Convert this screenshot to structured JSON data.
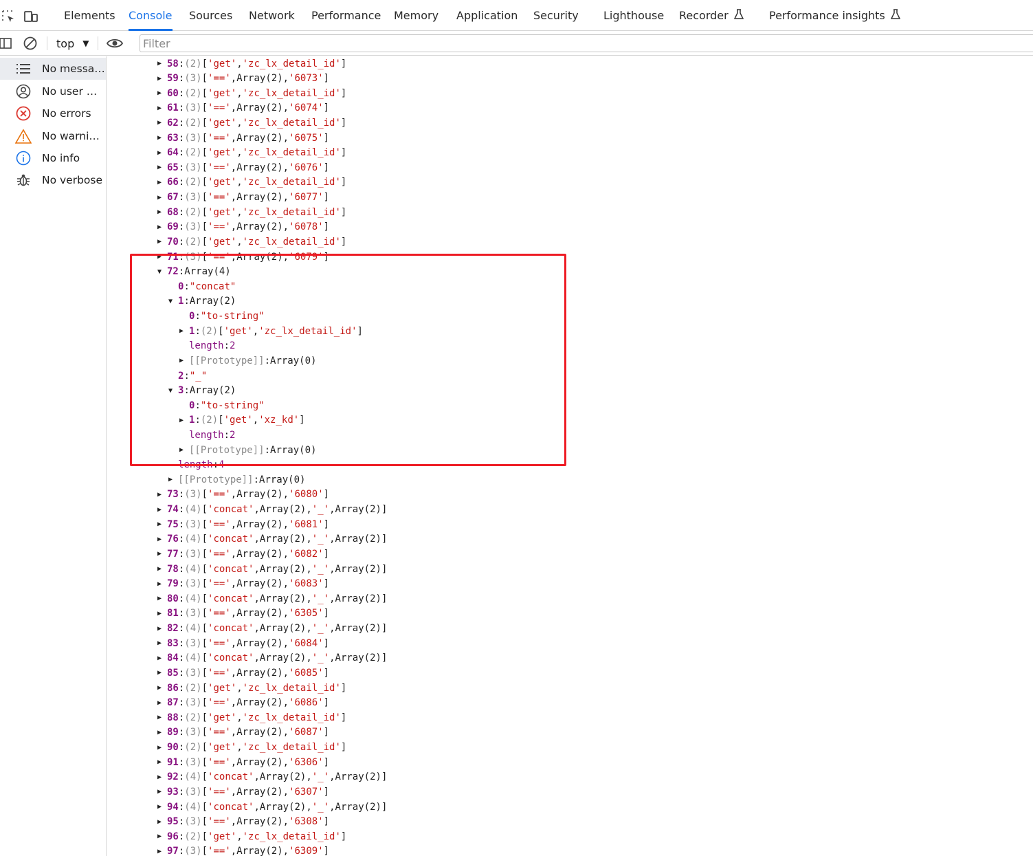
{
  "tabbar": {
    "tabs": [
      "Elements",
      "Console",
      "Sources",
      "Network",
      "Performance",
      "Memory",
      "Application",
      "Security",
      "Lighthouse",
      "Recorder",
      "Performance insights"
    ],
    "active": "Console"
  },
  "toolbar": {
    "context": "top",
    "filter_placeholder": "Filter"
  },
  "sidebar": {
    "items": [
      {
        "label": "No messag...",
        "icon": "list-icon"
      },
      {
        "label": "No user m...",
        "icon": "user-icon"
      },
      {
        "label": "No errors",
        "icon": "error-icon"
      },
      {
        "label": "No warnings",
        "icon": "warning-icon"
      },
      {
        "label": "No info",
        "icon": "info-icon"
      },
      {
        "label": "No verbose",
        "icon": "bug-icon"
      }
    ]
  },
  "console": {
    "before": [
      {
        "i": "58",
        "n": "(2)",
        "items": [
          "'get'",
          "'zc_lx_detail_id'"
        ]
      },
      {
        "i": "59",
        "n": "(3)",
        "items": [
          "'=='",
          "Array(2)",
          "'6073'"
        ]
      },
      {
        "i": "60",
        "n": "(2)",
        "items": [
          "'get'",
          "'zc_lx_detail_id'"
        ]
      },
      {
        "i": "61",
        "n": "(3)",
        "items": [
          "'=='",
          "Array(2)",
          "'6074'"
        ]
      },
      {
        "i": "62",
        "n": "(2)",
        "items": [
          "'get'",
          "'zc_lx_detail_id'"
        ]
      },
      {
        "i": "63",
        "n": "(3)",
        "items": [
          "'=='",
          "Array(2)",
          "'6075'"
        ]
      },
      {
        "i": "64",
        "n": "(2)",
        "items": [
          "'get'",
          "'zc_lx_detail_id'"
        ]
      },
      {
        "i": "65",
        "n": "(3)",
        "items": [
          "'=='",
          "Array(2)",
          "'6076'"
        ]
      },
      {
        "i": "66",
        "n": "(2)",
        "items": [
          "'get'",
          "'zc_lx_detail_id'"
        ]
      },
      {
        "i": "67",
        "n": "(3)",
        "items": [
          "'=='",
          "Array(2)",
          "'6077'"
        ]
      },
      {
        "i": "68",
        "n": "(2)",
        "items": [
          "'get'",
          "'zc_lx_detail_id'"
        ]
      },
      {
        "i": "69",
        "n": "(3)",
        "items": [
          "'=='",
          "Array(2)",
          "'6078'"
        ]
      },
      {
        "i": "70",
        "n": "(2)",
        "items": [
          "'get'",
          "'zc_lx_detail_id'"
        ]
      },
      {
        "i": "71",
        "n": "(3)",
        "items": [
          "'=='",
          "Array(2)",
          "'6079'"
        ]
      }
    ],
    "expanded": {
      "header": {
        "i": "72",
        "value": "Array(4)"
      },
      "rows": [
        {
          "depth": 1,
          "tri": "",
          "key": "0",
          "kind": "str",
          "value": "\"concat\""
        },
        {
          "depth": 1,
          "tri": "down",
          "key": "1",
          "kind": "plain",
          "value": "Array(2)"
        },
        {
          "depth": 2,
          "tri": "",
          "key": "0",
          "kind": "str",
          "value": "\"to-string\""
        },
        {
          "depth": 2,
          "tri": "right",
          "key": "1",
          "kind": "arr",
          "n": "(2)",
          "items": [
            "'get'",
            "'zc_lx_detail_id'"
          ]
        },
        {
          "depth": 2,
          "tri": "",
          "key": "length",
          "kind": "num",
          "value": "2"
        },
        {
          "depth": 2,
          "tri": "right",
          "key": "[[Prototype]]",
          "kind": "proto",
          "value": "Array(0)"
        },
        {
          "depth": 1,
          "tri": "",
          "key": "2",
          "kind": "str",
          "value": "\"_\""
        },
        {
          "depth": 1,
          "tri": "down",
          "key": "3",
          "kind": "plain",
          "value": "Array(2)"
        },
        {
          "depth": 2,
          "tri": "",
          "key": "0",
          "kind": "str",
          "value": "\"to-string\""
        },
        {
          "depth": 2,
          "tri": "right",
          "key": "1",
          "kind": "arr",
          "n": "(2)",
          "items": [
            "'get'",
            "'xz_kd'"
          ]
        },
        {
          "depth": 2,
          "tri": "",
          "key": "length",
          "kind": "num",
          "value": "2"
        },
        {
          "depth": 2,
          "tri": "right",
          "key": "[[Prototype]]",
          "kind": "proto",
          "value": "Array(0)"
        },
        {
          "depth": 1,
          "tri": "",
          "key": "length",
          "kind": "num",
          "value": "4"
        },
        {
          "depth": 1,
          "tri": "right",
          "key": "[[Prototype]]",
          "kind": "proto",
          "value": "Array(0)"
        }
      ]
    },
    "after": [
      {
        "i": "73",
        "n": "(3)",
        "items": [
          "'=='",
          "Array(2)",
          "'6080'"
        ]
      },
      {
        "i": "74",
        "n": "(4)",
        "items": [
          "'concat'",
          "Array(2)",
          "'_'",
          "Array(2)"
        ]
      },
      {
        "i": "75",
        "n": "(3)",
        "items": [
          "'=='",
          "Array(2)",
          "'6081'"
        ]
      },
      {
        "i": "76",
        "n": "(4)",
        "items": [
          "'concat'",
          "Array(2)",
          "'_'",
          "Array(2)"
        ]
      },
      {
        "i": "77",
        "n": "(3)",
        "items": [
          "'=='",
          "Array(2)",
          "'6082'"
        ]
      },
      {
        "i": "78",
        "n": "(4)",
        "items": [
          "'concat'",
          "Array(2)",
          "'_'",
          "Array(2)"
        ]
      },
      {
        "i": "79",
        "n": "(3)",
        "items": [
          "'=='",
          "Array(2)",
          "'6083'"
        ]
      },
      {
        "i": "80",
        "n": "(4)",
        "items": [
          "'concat'",
          "Array(2)",
          "'_'",
          "Array(2)"
        ]
      },
      {
        "i": "81",
        "n": "(3)",
        "items": [
          "'=='",
          "Array(2)",
          "'6305'"
        ]
      },
      {
        "i": "82",
        "n": "(4)",
        "items": [
          "'concat'",
          "Array(2)",
          "'_'",
          "Array(2)"
        ]
      },
      {
        "i": "83",
        "n": "(3)",
        "items": [
          "'=='",
          "Array(2)",
          "'6084'"
        ]
      },
      {
        "i": "84",
        "n": "(4)",
        "items": [
          "'concat'",
          "Array(2)",
          "'_'",
          "Array(2)"
        ]
      },
      {
        "i": "85",
        "n": "(3)",
        "items": [
          "'=='",
          "Array(2)",
          "'6085'"
        ]
      },
      {
        "i": "86",
        "n": "(2)",
        "items": [
          "'get'",
          "'zc_lx_detail_id'"
        ]
      },
      {
        "i": "87",
        "n": "(3)",
        "items": [
          "'=='",
          "Array(2)",
          "'6086'"
        ]
      },
      {
        "i": "88",
        "n": "(2)",
        "items": [
          "'get'",
          "'zc_lx_detail_id'"
        ]
      },
      {
        "i": "89",
        "n": "(3)",
        "items": [
          "'=='",
          "Array(2)",
          "'6087'"
        ]
      },
      {
        "i": "90",
        "n": "(2)",
        "items": [
          "'get'",
          "'zc_lx_detail_id'"
        ]
      },
      {
        "i": "91",
        "n": "(3)",
        "items": [
          "'=='",
          "Array(2)",
          "'6306'"
        ]
      },
      {
        "i": "92",
        "n": "(4)",
        "items": [
          "'concat'",
          "Array(2)",
          "'_'",
          "Array(2)"
        ]
      },
      {
        "i": "93",
        "n": "(3)",
        "items": [
          "'=='",
          "Array(2)",
          "'6307'"
        ]
      },
      {
        "i": "94",
        "n": "(4)",
        "items": [
          "'concat'",
          "Array(2)",
          "'_'",
          "Array(2)"
        ]
      },
      {
        "i": "95",
        "n": "(3)",
        "items": [
          "'=='",
          "Array(2)",
          "'6308'"
        ]
      },
      {
        "i": "96",
        "n": "(2)",
        "items": [
          "'get'",
          "'zc_lx_detail_id'"
        ]
      },
      {
        "i": "97",
        "n": "(3)",
        "items": [
          "'=='",
          "Array(2)",
          "'6309'"
        ]
      }
    ]
  },
  "colors": {
    "accent": "#1a73e8",
    "highlight": "#ee1c25",
    "index": "#881280",
    "string": "#c41a16"
  }
}
